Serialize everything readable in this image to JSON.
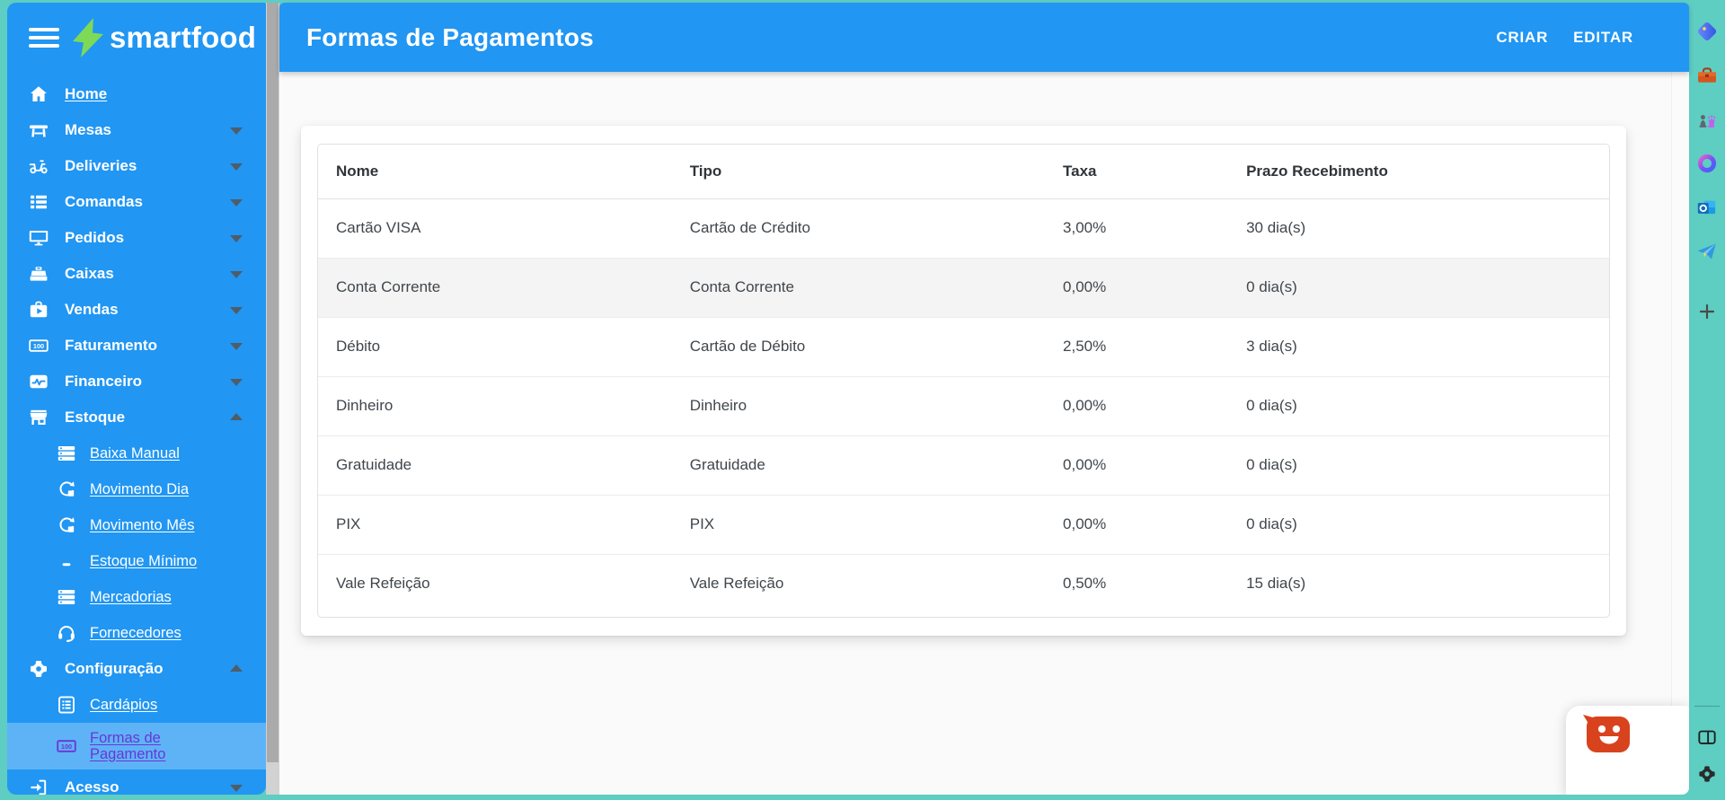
{
  "colors": {
    "accent_blue": "#2196f3",
    "frame_teal": "#5ecdc2",
    "active_purple": "#6c35d6",
    "logo_green": "#7ed957",
    "chat_orange": "#d8431d"
  },
  "sidebar": {
    "logo_text": "smartfood",
    "items": [
      {
        "label": "Home",
        "icon": "home-icon",
        "type": "link"
      },
      {
        "label": "Mesas",
        "icon": "table-icon",
        "chevron": "down"
      },
      {
        "label": "Deliveries",
        "icon": "scooter-icon",
        "chevron": "down"
      },
      {
        "label": "Comandas",
        "icon": "list-icon",
        "chevron": "down"
      },
      {
        "label": "Pedidos",
        "icon": "monitor-icon",
        "chevron": "down"
      },
      {
        "label": "Caixas",
        "icon": "cash-register-icon",
        "chevron": "down"
      },
      {
        "label": "Vendas",
        "icon": "briefcase-icon",
        "chevron": "down"
      },
      {
        "label": "Faturamento",
        "icon": "banknote-icon",
        "chevron": "down"
      },
      {
        "label": "Financeiro",
        "icon": "chart-icon",
        "chevron": "down"
      },
      {
        "label": "Estoque",
        "icon": "store-icon",
        "chevron": "up"
      },
      {
        "label": "Baixa Manual",
        "icon": "rows-icon",
        "type": "sublink"
      },
      {
        "label": "Movimento Dia",
        "icon": "sync-icon",
        "type": "sublink"
      },
      {
        "label": "Movimento Mês",
        "icon": "sync-icon",
        "type": "sublink"
      },
      {
        "label": "Estoque Mínimo",
        "icon": "dash-icon",
        "type": "sublink"
      },
      {
        "label": "Mercadorias",
        "icon": "rows-icon",
        "type": "sublink"
      },
      {
        "label": "Fornecedores",
        "icon": "headset-icon",
        "type": "sublink"
      },
      {
        "label": "Configuração",
        "icon": "gear-icon",
        "chevron": "up"
      },
      {
        "label": "Cardápios",
        "icon": "menu-list-icon",
        "type": "sublink"
      },
      {
        "label": "Formas de Pagamento",
        "icon": "banknote-icon",
        "type": "sublink",
        "active": true
      },
      {
        "label": "Acesso",
        "icon": "login-icon",
        "chevron": "down"
      }
    ]
  },
  "header": {
    "title": "Formas de Pagamentos",
    "actions": [
      {
        "label": "CRIAR"
      },
      {
        "label": "EDITAR"
      }
    ]
  },
  "table": {
    "columns": [
      "Nome",
      "Tipo",
      "Taxa",
      "Prazo Recebimento"
    ],
    "rows": [
      {
        "nome": "Cartão VISA",
        "tipo": "Cartão de Crédito",
        "taxa": "3,00%",
        "prazo": "30 dia(s)"
      },
      {
        "nome": "Conta Corrente",
        "tipo": "Conta Corrente",
        "taxa": "0,00%",
        "prazo": "0 dia(s)",
        "highlighted": true
      },
      {
        "nome": "Débito",
        "tipo": "Cartão de Débito",
        "taxa": "2,50%",
        "prazo": "3 dia(s)"
      },
      {
        "nome": "Dinheiro",
        "tipo": "Dinheiro",
        "taxa": "0,00%",
        "prazo": "0 dia(s)"
      },
      {
        "nome": "Gratuidade",
        "tipo": "Gratuidade",
        "taxa": "0,00%",
        "prazo": "0 dia(s)"
      },
      {
        "nome": "PIX",
        "tipo": "PIX",
        "taxa": "0,00%",
        "prazo": "0 dia(s)"
      },
      {
        "nome": "Vale Refeição",
        "tipo": "Vale Refeição",
        "taxa": "0,50%",
        "prazo": "15 dia(s)"
      }
    ]
  },
  "browser_rail": {
    "top_icons": [
      {
        "name": "tag-icon"
      },
      {
        "name": "toolbox-icon"
      },
      {
        "name": "chess-icon"
      },
      {
        "name": "office-icon"
      },
      {
        "name": "outlook-icon"
      },
      {
        "name": "send-icon"
      },
      {
        "name": "add-icon"
      }
    ],
    "bottom_icons": [
      {
        "name": "sidebar-panel-icon"
      },
      {
        "name": "settings-gear-icon"
      }
    ]
  },
  "chat_widget": {
    "icon": "chat-smiley-icon"
  }
}
